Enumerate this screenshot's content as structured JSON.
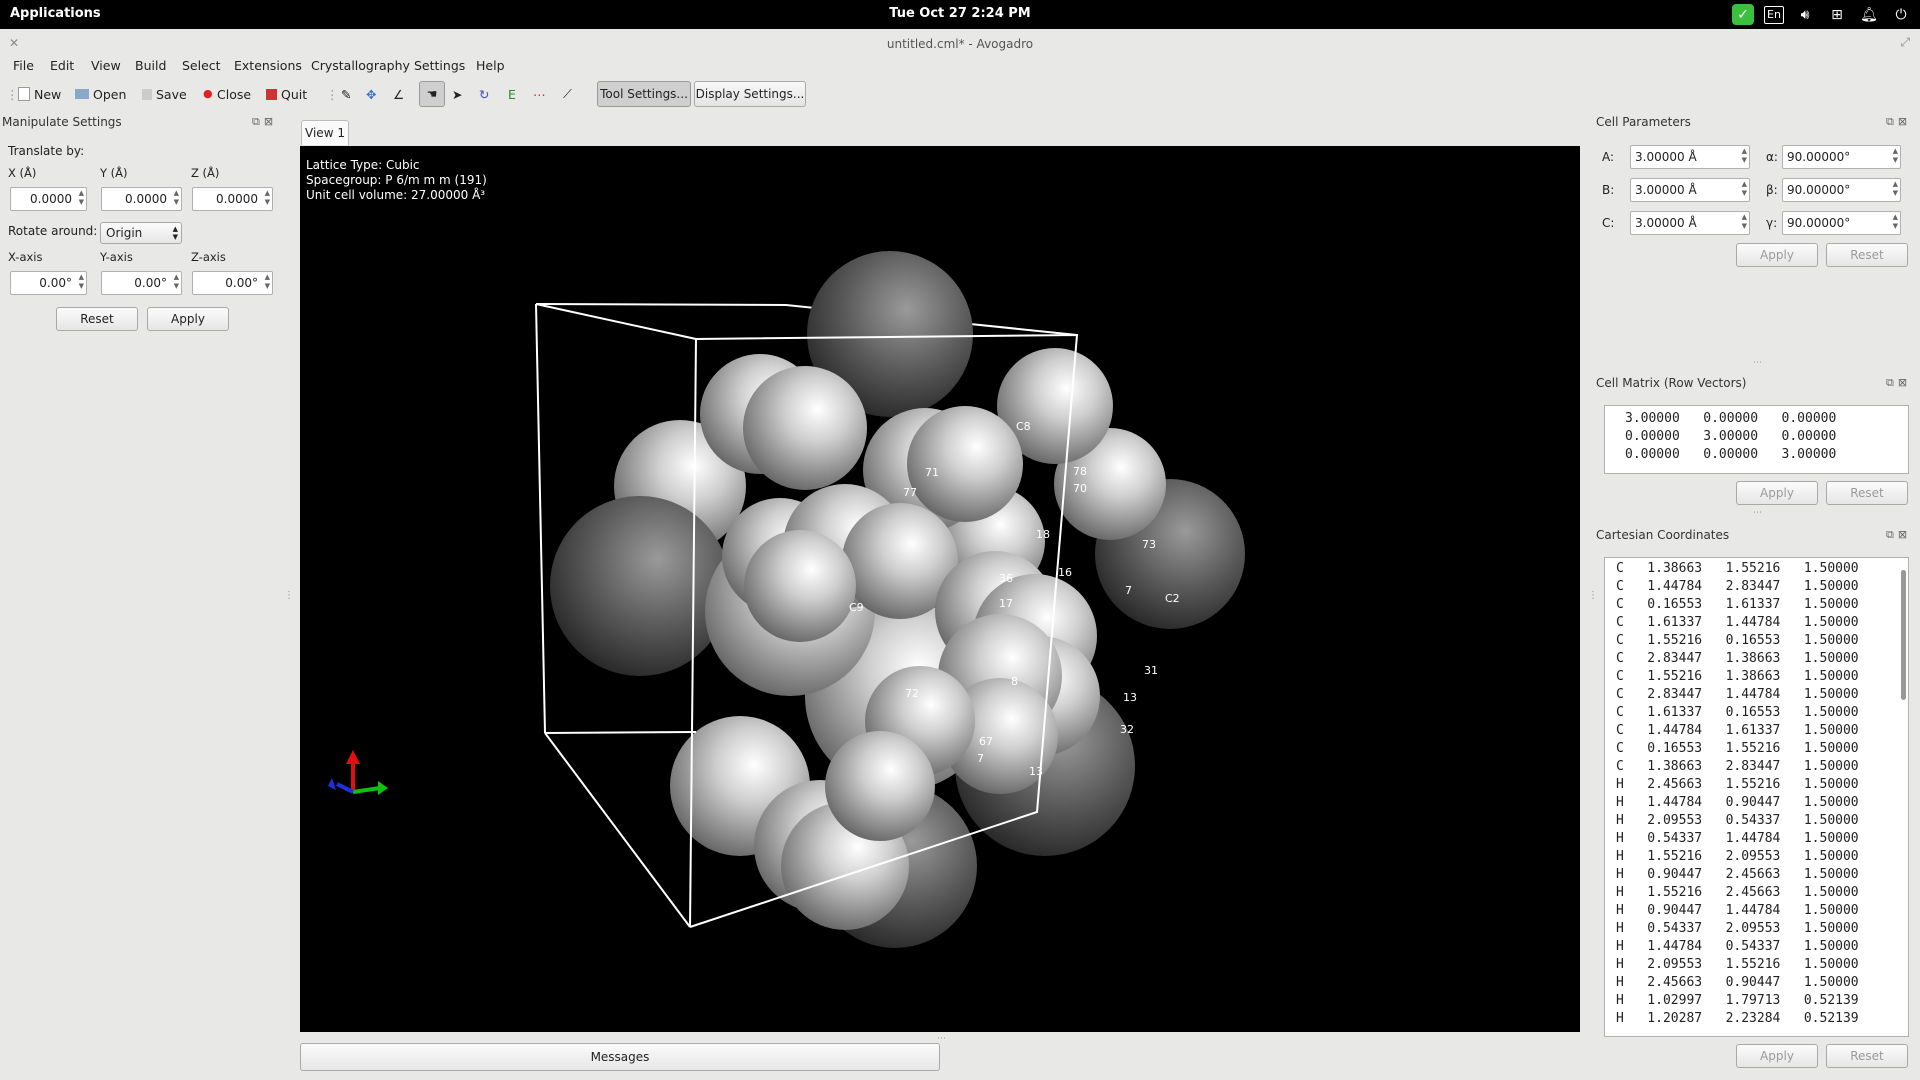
{
  "topbar": {
    "applications": "Applications",
    "clock": "Tue Oct 27    2:24 PM",
    "lang": "En"
  },
  "window": {
    "title": "untitled.cml* - Avogadro"
  },
  "menu": [
    "File",
    "Edit",
    "View",
    "Build",
    "Select",
    "Extensions",
    "Crystallography",
    "Settings",
    "Help"
  ],
  "toolbar": {
    "new": "New",
    "open": "Open",
    "save": "Save",
    "close": "Close",
    "quit": "Quit",
    "tool_settings": "Tool Settings...",
    "display_settings": "Display Settings..."
  },
  "manipulate": {
    "title": "Manipulate Settings",
    "translate_by": "Translate by:",
    "x_label": "X (Å)",
    "y_label": "Y (Å)",
    "z_label": "Z (Å)",
    "x_value": "0.0000",
    "y_value": "0.0000",
    "z_value": "0.0000",
    "rotate_around_label": "Rotate around:",
    "rotate_around_value": "Origin",
    "xaxis_label": "X-axis",
    "yaxis_label": "Y-axis",
    "zaxis_label": "Z-axis",
    "xaxis_value": "0.00°",
    "yaxis_value": "0.00°",
    "zaxis_value": "0.00°",
    "reset": "Reset",
    "apply": "Apply"
  },
  "view": {
    "tab": "View 1",
    "lattice": "Lattice Type: Cubic",
    "spacegroup": "Spacegroup: P 6/m m m (191)",
    "volume": "Unit cell volume: 27.00000 Å³",
    "atom_labels": [
      "C8",
      "78",
      "70",
      "71",
      "77",
      "18",
      "73",
      "16",
      "36",
      "C9",
      "17",
      "7",
      "C2",
      "31",
      "13",
      "8",
      "72",
      "67",
      "7",
      "32",
      "13"
    ]
  },
  "messages": "Messages",
  "cell_params": {
    "title": "Cell Parameters",
    "a_label": "A:",
    "b_label": "B:",
    "c_label": "C:",
    "a": "3.00000 Å",
    "b": "3.00000 Å",
    "c": "3.00000 Å",
    "alpha_label": "α:",
    "beta_label": "β:",
    "gamma_label": "γ:",
    "alpha": "90.00000°",
    "beta": "90.00000°",
    "gamma": "90.00000°",
    "apply": "Apply",
    "reset": "Reset"
  },
  "cell_matrix": {
    "title": "Cell Matrix (Row Vectors)",
    "rows": [
      "3.00000   0.00000   0.00000",
      "0.00000   3.00000   0.00000",
      "0.00000   0.00000   3.00000"
    ],
    "apply": "Apply",
    "reset": "Reset"
  },
  "cartesian": {
    "title": "Cartesian Coordinates",
    "rows": [
      "C   1.38663   1.55216   1.50000",
      "C   1.44784   2.83447   1.50000",
      "C   0.16553   1.61337   1.50000",
      "C   1.61337   1.44784   1.50000",
      "C   1.55216   0.16553   1.50000",
      "C   2.83447   1.38663   1.50000",
      "C   1.55216   1.38663   1.50000",
      "C   2.83447   1.44784   1.50000",
      "C   1.61337   0.16553   1.50000",
      "C   1.44784   1.61337   1.50000",
      "C   0.16553   1.55216   1.50000",
      "C   1.38663   2.83447   1.50000",
      "H   2.45663   1.55216   1.50000",
      "H   1.44784   0.90447   1.50000",
      "H   2.09553   0.54337   1.50000",
      "H   0.54337   1.44784   1.50000",
      "H   1.55216   2.09553   1.50000",
      "H   0.90447   2.45663   1.50000",
      "H   1.55216   2.45663   1.50000",
      "H   0.90447   1.44784   1.50000",
      "H   0.54337   2.09553   1.50000",
      "H   1.44784   0.54337   1.50000",
      "H   2.09553   1.55216   1.50000",
      "H   2.45663   0.90447   1.50000",
      "H   1.02997   1.79713   0.52139",
      "H   1.20287   2.23284   0.52139"
    ],
    "apply": "Apply",
    "reset": "Reset"
  }
}
